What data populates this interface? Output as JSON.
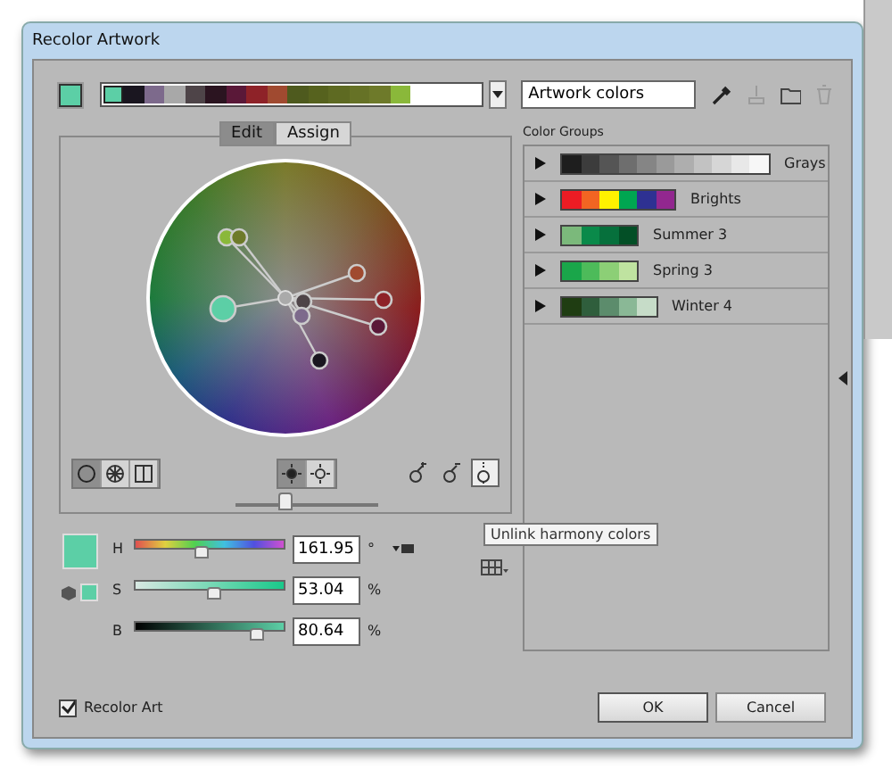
{
  "window": {
    "title": "Recolor Artwork"
  },
  "current_swatch": {
    "color": "#5ccfa6"
  },
  "color_bar": {
    "swatches": [
      {
        "color": "#5ccfa6",
        "selected": true
      },
      {
        "color": "#1a1620"
      },
      {
        "color": "#7d6a8c"
      },
      {
        "color": "#a8a8a8"
      },
      {
        "color": "#4e4448"
      },
      {
        "color": "#2b1420"
      },
      {
        "color": "#5a1838"
      },
      {
        "color": "#8e2228"
      },
      {
        "color": "#a04a30"
      },
      {
        "color": "#4e5a1e"
      },
      {
        "color": "#56621e"
      },
      {
        "color": "#5e6a22"
      },
      {
        "color": "#667226"
      },
      {
        "color": "#6e7a2a"
      },
      {
        "color": "#8ab83a"
      }
    ]
  },
  "name_field": {
    "value": "Artwork colors"
  },
  "tabs": [
    {
      "label": "Edit",
      "selected": true
    },
    {
      "label": "Assign",
      "selected": false
    }
  ],
  "wheel_modes": [
    {
      "kind": "smooth",
      "selected": true
    },
    {
      "kind": "segmented",
      "selected": false
    },
    {
      "kind": "bars",
      "selected": false
    }
  ],
  "wheel_display": [
    {
      "kind": "brightness",
      "selected": true
    },
    {
      "kind": "saturation",
      "selected": false
    }
  ],
  "wheel_slider": {
    "level": 0.35
  },
  "harmony_tools": [
    {
      "kind": "add",
      "selected": false
    },
    {
      "kind": "remove",
      "selected": false
    },
    {
      "kind": "unlink",
      "selected": true
    }
  ],
  "tooltip": "Unlink harmony colors",
  "hsb": [
    {
      "label": "H",
      "kind": "hue",
      "level": 0.45,
      "value": "161.95",
      "unit": "°"
    },
    {
      "label": "S",
      "kind": "saturation",
      "level": 0.53,
      "value": "53.04",
      "unit": "%"
    },
    {
      "label": "B",
      "kind": "brightness",
      "level": 0.81,
      "value": "80.64",
      "unit": "%"
    }
  ],
  "color_groups": {
    "title": "Color Groups",
    "groups": [
      {
        "name": "Grays",
        "expanded": false,
        "swatches": [
          {
            "color": "#1e1e1e"
          },
          {
            "color": "#3c3c3c"
          },
          {
            "color": "#555555"
          },
          {
            "color": "#6e6e6e"
          },
          {
            "color": "#858585"
          },
          {
            "color": "#9a9a9a"
          },
          {
            "color": "#aeaeae"
          },
          {
            "color": "#c2c2c2"
          },
          {
            "color": "#d6d6d6"
          },
          {
            "color": "#e8e8e8"
          },
          {
            "color": "#f7f7f7"
          }
        ]
      },
      {
        "name": "Brights",
        "expanded": false,
        "swatches": [
          {
            "color": "#ec1c24"
          },
          {
            "color": "#f26522"
          },
          {
            "color": "#fff200"
          },
          {
            "color": "#00a651"
          },
          {
            "color": "#2e3192"
          },
          {
            "color": "#92278f"
          }
        ]
      },
      {
        "name": "Summer 3",
        "expanded": false,
        "swatches": [
          {
            "color": "#7bb97b"
          },
          {
            "color": "#0a8a4a"
          },
          {
            "color": "#06703c"
          },
          {
            "color": "#034f26"
          }
        ]
      },
      {
        "name": "Spring 3",
        "expanded": false,
        "swatches": [
          {
            "color": "#1aa64a"
          },
          {
            "color": "#4dbb5a"
          },
          {
            "color": "#8ccf76"
          },
          {
            "color": "#bfe3a0"
          }
        ]
      },
      {
        "name": "Winter 4",
        "expanded": false,
        "swatches": [
          {
            "color": "#1f3d12"
          },
          {
            "color": "#2f5e3c"
          },
          {
            "color": "#5c8c6c"
          },
          {
            "color": "#8ab896"
          },
          {
            "color": "#c6dcc8"
          }
        ]
      }
    ]
  },
  "recolor_art": {
    "label": "Recolor Art",
    "checked": true
  },
  "buttons": [
    {
      "label": "OK",
      "kind": "default"
    },
    {
      "label": "Cancel",
      "kind": "normal"
    }
  ]
}
